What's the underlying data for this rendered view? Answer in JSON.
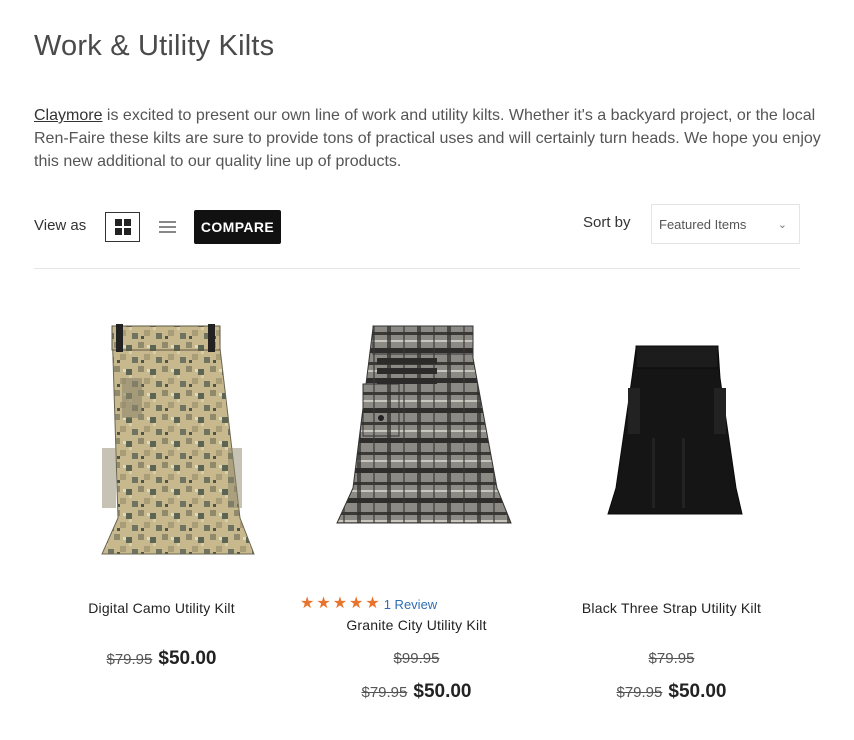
{
  "page": {
    "title": "Work & Utility Kilts",
    "intro_link": "Claymore",
    "intro_text": " is excited to present our own line of work and utility kilts.  Whether it's a backyard project, or the local Ren-Faire these kilts are sure to provide tons of practical uses and will certainly turn heads.  We hope you enjoy this new additional to our quality line up of products."
  },
  "toolbar": {
    "view_label": "View as",
    "grid_icon": "grid-view-icon",
    "list_icon": "list-view-icon",
    "compare_label": "COMPARE",
    "sort_label": "Sort by",
    "sort_value": "Featured Items"
  },
  "products": [
    {
      "name": "Digital Camo Utility Kilt",
      "was_price": "$79.95",
      "price": "$50.00"
    },
    {
      "name": "Granite City Utility Kilt",
      "rating": 5,
      "review_text": "1 Review",
      "retail_price": "$99.95",
      "was_price": "$79.95",
      "price": "$50.00"
    },
    {
      "name": "Black Three Strap Utility Kilt",
      "retail_price": "$79.95",
      "was_price": "$79.95",
      "price": "$50.00"
    }
  ],
  "colors": {
    "star": "#e8732c",
    "link": "#2f6db5",
    "button": "#111111"
  }
}
